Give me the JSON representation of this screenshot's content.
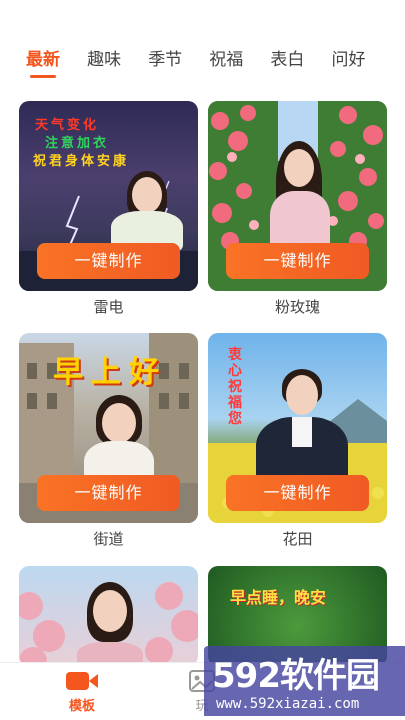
{
  "tabs": [
    {
      "label": "最新",
      "active": true
    },
    {
      "label": "趣味",
      "active": false
    },
    {
      "label": "季节",
      "active": false
    },
    {
      "label": "祝福",
      "active": false
    },
    {
      "label": "表白",
      "active": false
    },
    {
      "label": "问好",
      "active": false
    }
  ],
  "cards": [
    {
      "button": "一键制作",
      "caption": "雷电",
      "overlay_lines": [
        "天气变化",
        "注意加衣",
        "祝君身体安康"
      ]
    },
    {
      "button": "一键制作",
      "caption": "粉玫瑰"
    },
    {
      "button": "一键制作",
      "caption": "街道",
      "overlay_lines": [
        "早上好"
      ]
    },
    {
      "button": "一键制作",
      "caption": "花田",
      "overlay_lines": [
        "衷心祝福您"
      ]
    },
    {
      "button": "",
      "caption": ""
    },
    {
      "button": "",
      "caption": "",
      "overlay_lines": [
        "早点睡，晚安"
      ]
    }
  ],
  "nav": [
    {
      "label": "模板",
      "icon": "video-camera-icon",
      "active": true
    },
    {
      "label": "玩",
      "icon": "image-icon",
      "active": false
    }
  ],
  "watermark": {
    "top": "592软件园",
    "bottom": "www.592xiazai.com"
  },
  "colors": {
    "accent": "#f4561e"
  }
}
